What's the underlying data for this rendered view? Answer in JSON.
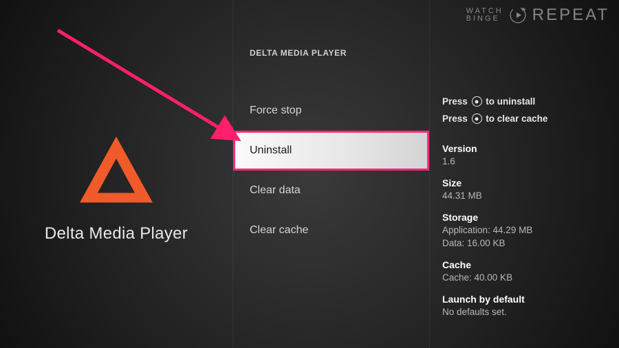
{
  "left": {
    "app_name": "Delta Media Player",
    "icon_name": "triangle-icon",
    "icon_color": "#f15a29"
  },
  "mid": {
    "title": "DELTA MEDIA PLAYER",
    "items": [
      {
        "label": "Force stop",
        "selected": false
      },
      {
        "label": "Uninstall",
        "selected": true
      },
      {
        "label": "Clear data",
        "selected": false
      },
      {
        "label": "Clear cache",
        "selected": false
      }
    ]
  },
  "right": {
    "hints": [
      {
        "pre": "Press ",
        "post": " to uninstall"
      },
      {
        "pre": "Press ",
        "post": " to clear cache"
      }
    ],
    "info": [
      {
        "label": "Version",
        "lines": [
          "1.6"
        ]
      },
      {
        "label": "Size",
        "lines": [
          "44.31 MB"
        ]
      },
      {
        "label": "Storage",
        "lines": [
          "Application: 44.29 MB",
          "Data: 16.00 KB"
        ]
      },
      {
        "label": "Cache",
        "lines": [
          "Cache: 40.00 KB"
        ]
      },
      {
        "label": "Launch by default",
        "lines": [
          "No defaults set."
        ]
      }
    ]
  },
  "watermark": {
    "line1": "WATCH",
    "line2": "BINGE",
    "repeat": "REPEAT"
  },
  "accent": "#ff2a7a"
}
